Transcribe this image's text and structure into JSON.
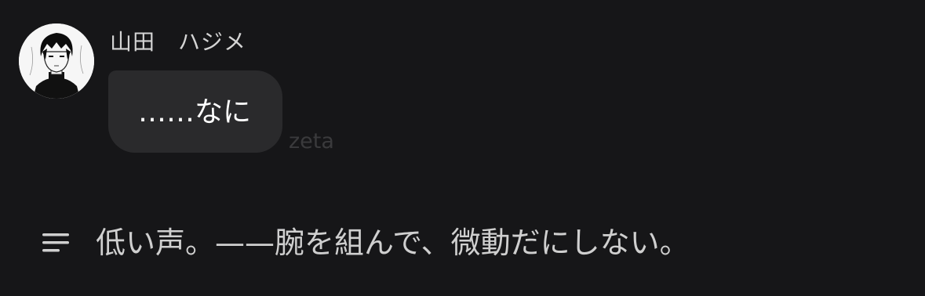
{
  "message": {
    "sender_name": "山田　ハジメ",
    "text": "……なに",
    "avatar_icon": "character-avatar-icon"
  },
  "watermark": "zeta",
  "narration": {
    "icon": "lines-menu-icon",
    "text": "低い声。——腕を組んで、微動だにしない。"
  },
  "colors": {
    "background": "#161618",
    "bubble": "#2a2a2c",
    "text": "#ffffff",
    "name": "#d4d4d4",
    "watermark": "#3a3a3c"
  }
}
